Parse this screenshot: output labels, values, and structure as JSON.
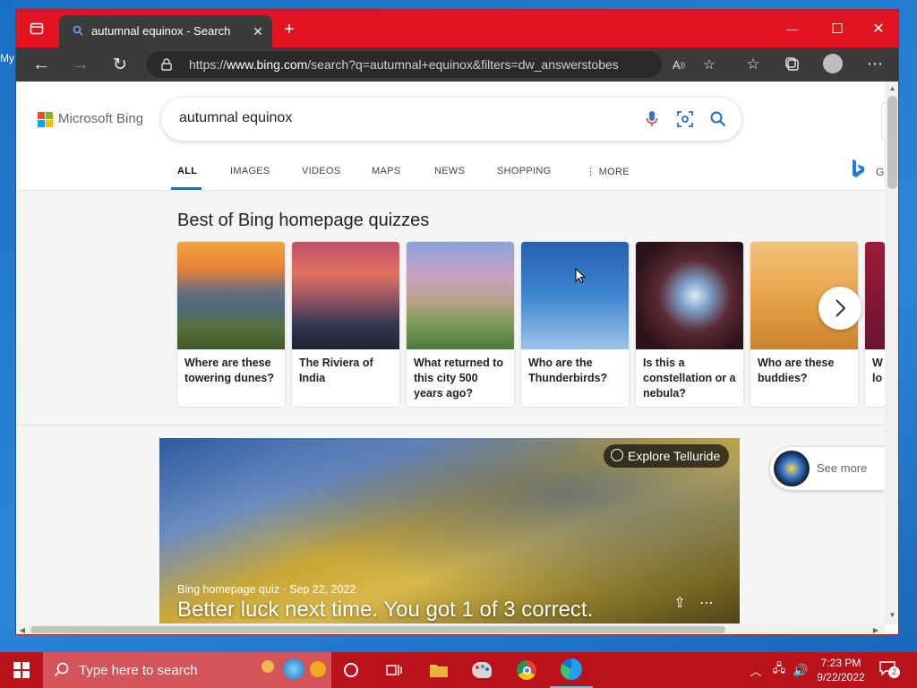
{
  "desktop": {
    "icon_label": "My"
  },
  "browser": {
    "tab_title": "autumnal equinox - Search",
    "url_prefix": "https://",
    "url_domain": "www.bing.com",
    "url_path": "/search?q=autumnal+equinox&filters=dw_answerstobesupp...",
    "window_controls": {
      "minimize": "—",
      "maximize": "☐",
      "close": "✕"
    }
  },
  "bing": {
    "logo_text": "Microsoft Bing",
    "query": "autumnal equinox",
    "nav": [
      "ALL",
      "IMAGES",
      "VIDEOS",
      "MAPS",
      "NEWS",
      "SHOPPING",
      "MORE"
    ],
    "active_nav": "ALL",
    "right_label": "G",
    "quiz_heading": "Best of Bing homepage quizzes",
    "quiz_cards": [
      {
        "caption": "Where are these towering dunes?"
      },
      {
        "caption": "The Riviera of India"
      },
      {
        "caption": "What returned to this city 500 years ago?"
      },
      {
        "caption": "Who are the Thunderbirds?"
      },
      {
        "caption": "Is this a constellation or a nebula?"
      },
      {
        "caption": "Who are these buddies?"
      },
      {
        "caption": "W lo"
      }
    ],
    "hero": {
      "explore": "Explore Telluride",
      "meta": "Bing homepage quiz · Sep 22, 2022",
      "headline": "Better luck next time. You got 1 of 3 correct."
    },
    "see_more": "See more"
  },
  "taskbar": {
    "search_placeholder": "Type here to search",
    "time": "7:23 PM",
    "date": "9/22/2022",
    "notifications": "2"
  }
}
